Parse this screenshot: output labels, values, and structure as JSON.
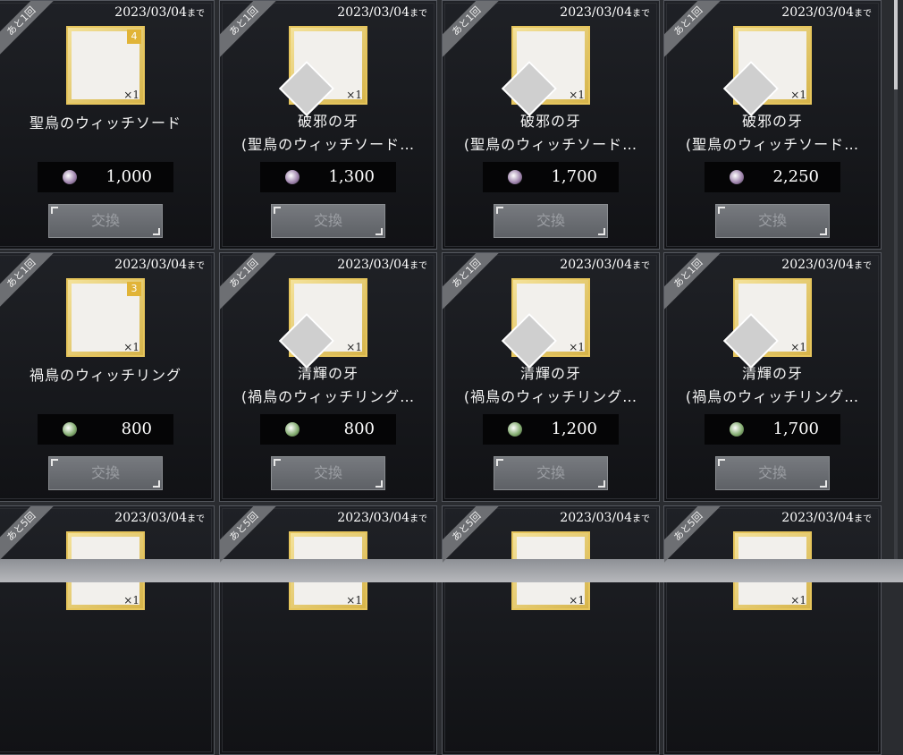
{
  "labels": {
    "exchange_button": "交換",
    "deadline_suffix": "まで"
  },
  "cards": [
    {
      "badge": "あと1回",
      "deadline": "2023/03/04",
      "name": "聖鳥のウィッチソード",
      "name2": "",
      "price": "1,000",
      "currency": "purple-gem-icon",
      "rank": "4"
    },
    {
      "badge": "あと1回",
      "deadline": "2023/03/04",
      "name": "破邪の牙",
      "name2": "(聖鳥のウィッチソード…",
      "price": "1,300",
      "currency": "purple-gem-icon"
    },
    {
      "badge": "あと1回",
      "deadline": "2023/03/04",
      "name": "破邪の牙",
      "name2": "(聖鳥のウィッチソード…",
      "price": "1,700",
      "currency": "purple-gem-icon"
    },
    {
      "badge": "あと1回",
      "deadline": "2023/03/04",
      "name": "破邪の牙",
      "name2": "(聖鳥のウィッチソード…",
      "price": "2,250",
      "currency": "purple-gem-icon"
    },
    {
      "badge": "あと1回",
      "deadline": "2023/03/04",
      "name": "禍鳥のウィッチリング",
      "name2": "",
      "price": "800",
      "currency": "green-gem-icon",
      "rank": "3"
    },
    {
      "badge": "あと1回",
      "deadline": "2023/03/04",
      "name": "清輝の牙",
      "name2": "(禍鳥のウィッチリング…",
      "price": "800",
      "currency": "green-gem-icon"
    },
    {
      "badge": "あと1回",
      "deadline": "2023/03/04",
      "name": "清輝の牙",
      "name2": "(禍鳥のウィッチリング…",
      "price": "1,200",
      "currency": "green-gem-icon"
    },
    {
      "badge": "あと1回",
      "deadline": "2023/03/04",
      "name": "清輝の牙",
      "name2": "(禍鳥のウィッチリング…",
      "price": "1,700",
      "currency": "green-gem-icon"
    },
    {
      "badge": "あと5回",
      "deadline": "2023/03/04"
    },
    {
      "badge": "あと5回",
      "deadline": "2023/03/04"
    },
    {
      "badge": "あと5回",
      "deadline": "2023/03/04"
    },
    {
      "badge": "あと5回",
      "deadline": "2023/03/04"
    }
  ],
  "colors": {
    "purple-gem": "#9a7ea8",
    "green-gem": "#7ea86a",
    "rank-gold": "#e1b437"
  }
}
